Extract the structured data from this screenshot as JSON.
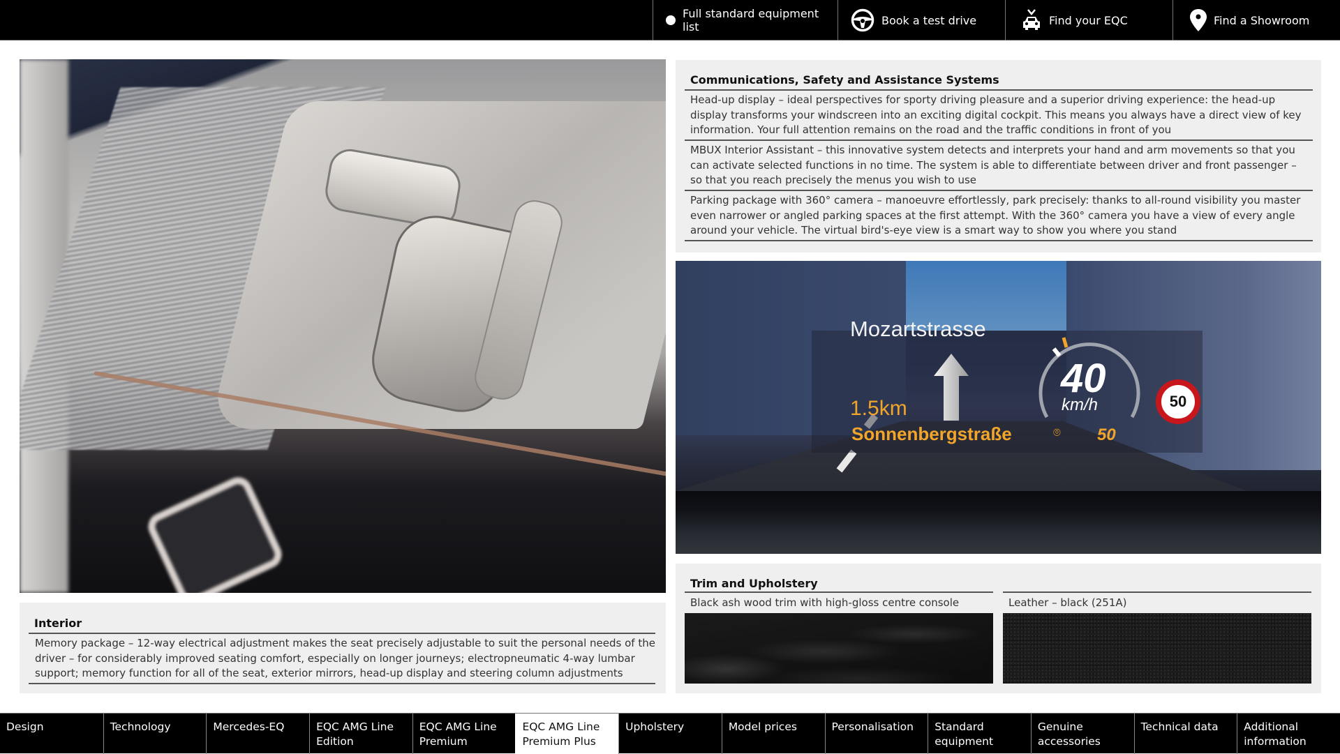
{
  "topnav": {
    "items": [
      {
        "label": "Full standard equipment list",
        "icon": "circle-icon"
      },
      {
        "label": "Book a test drive",
        "icon": "steering-wheel-icon"
      },
      {
        "label": "Find your EQC",
        "icon": "car-locate-icon"
      },
      {
        "label": "Find a Showroom",
        "icon": "map-pin-icon"
      }
    ]
  },
  "images": {
    "left_photo_alt": "Door panel with memory seat adjustment controls",
    "hud_photo_alt": "Head-up display projection on windscreen"
  },
  "hud": {
    "street": "Mozartstrasse",
    "distance": "1.5km",
    "destination": "Sonnenbergstraße",
    "speed": "40",
    "unit": "km/h",
    "limit_readout": "50",
    "sign_limit": "50"
  },
  "communications": {
    "title": "Communications, Safety and Assistance Systems",
    "items": [
      "Head-up display – ideal perspectives for sporty driving pleasure and a superior driving experience: the head-up display transforms your windscreen into an exciting digital cockpit. This means you always have a direct view of key information. Your full attention remains on the road and the traffic conditions in front of you",
      "MBUX Interior Assistant – this innovative system detects and interprets your hand and arm movements so that you can activate selected functions in no time. The system is able to differentiate between driver and front passenger – so that you reach precisely the menus you wish to use",
      "Parking package with 360° camera – manoeuvre effortlessly, park precisely: thanks to all-round visibility you master even narrower or angled parking spaces at the first attempt. With the 360° camera you have a view of every angle around your vehicle. The virtual bird's-eye view is a smart way to show you where you stand"
    ]
  },
  "interior": {
    "title": "Interior",
    "items": [
      "Memory package – 12-way electrical adjustment makes the seat precisely adjustable to suit the personal needs of the driver – for considerably improved seating comfort, especially on longer journeys; electropneumatic 4-way lumbar support; memory function for all of the seat, exterior mirrors, head-up display and steering column adjustments"
    ]
  },
  "trim": {
    "title": "Trim and Upholstery",
    "swatches": [
      {
        "label": "Black ash wood trim with high-gloss centre console"
      },
      {
        "label": "Leather – black (251A)"
      }
    ]
  },
  "bottomnav": {
    "active_index": 5,
    "items": [
      {
        "label": "Design"
      },
      {
        "label": "Technology"
      },
      {
        "label": "Mercedes-EQ"
      },
      {
        "label": "EQC AMG Line Edition"
      },
      {
        "label": "EQC AMG Line Premium"
      },
      {
        "label": "EQC AMG Line Premium Plus"
      },
      {
        "label": "Upholstery"
      },
      {
        "label": "Model prices"
      },
      {
        "label": "Personalisation"
      },
      {
        "label": "Standard equipment"
      },
      {
        "label": "Genuine accessories"
      },
      {
        "label": "Technical data"
      },
      {
        "label": "Additional information"
      }
    ]
  },
  "colors": {
    "nav_bg": "#000000",
    "panel_bg": "#efefef",
    "hud_accent": "#f2a52b",
    "sign_red": "#c8161d"
  }
}
